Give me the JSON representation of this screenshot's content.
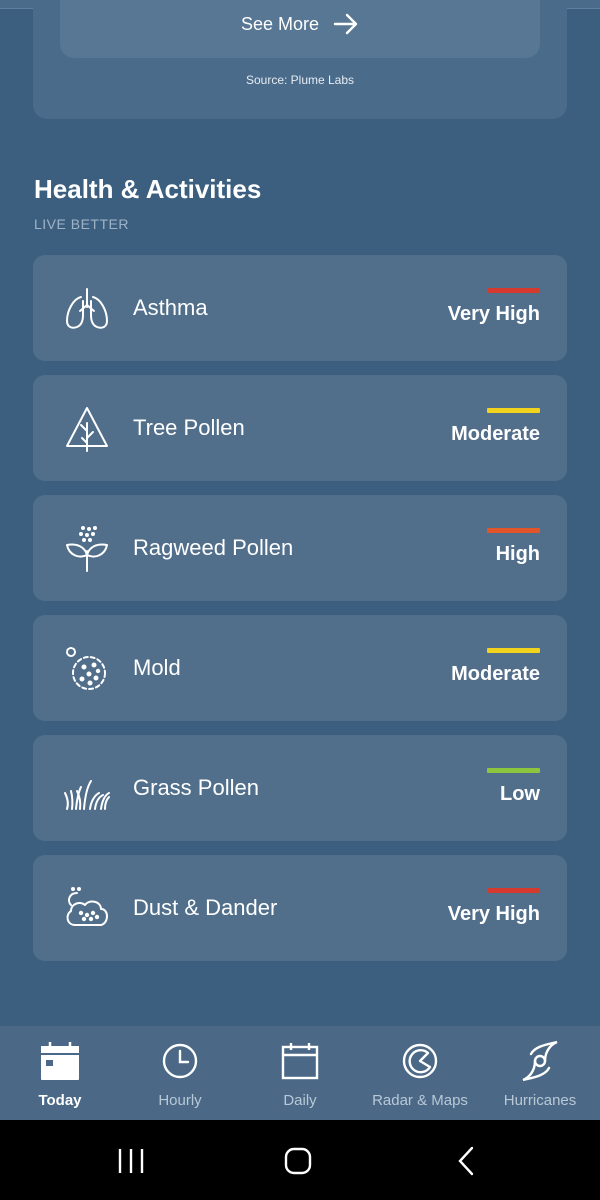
{
  "air_quality": {
    "see_more_label": "See More",
    "source": "Source: Plume Labs"
  },
  "health": {
    "title": "Health & Activities",
    "subtitle": "LIVE BETTER",
    "items": [
      {
        "name": "Asthma",
        "level": "Very High",
        "color": "#d63a2f",
        "icon": "lungs-icon"
      },
      {
        "name": "Tree Pollen",
        "level": "Moderate",
        "color": "#f1d21c",
        "icon": "tree-icon"
      },
      {
        "name": "Ragweed Pollen",
        "level": "High",
        "color": "#e2552b",
        "icon": "ragweed-icon"
      },
      {
        "name": "Mold",
        "level": "Moderate",
        "color": "#f1d21c",
        "icon": "mold-icon"
      },
      {
        "name": "Grass Pollen",
        "level": "Low",
        "color": "#8cc63f",
        "icon": "grass-icon"
      },
      {
        "name": "Dust & Dander",
        "level": "Very High",
        "color": "#d63a2f",
        "icon": "dust-icon"
      }
    ]
  },
  "tabs": [
    {
      "label": "Today",
      "icon": "calendar-today-icon",
      "active": true
    },
    {
      "label": "Hourly",
      "icon": "clock-icon",
      "active": false
    },
    {
      "label": "Daily",
      "icon": "calendar-icon",
      "active": false
    },
    {
      "label": "Radar & Maps",
      "icon": "radar-icon",
      "active": false
    },
    {
      "label": "Hurricanes",
      "icon": "hurricane-icon",
      "active": false
    }
  ]
}
